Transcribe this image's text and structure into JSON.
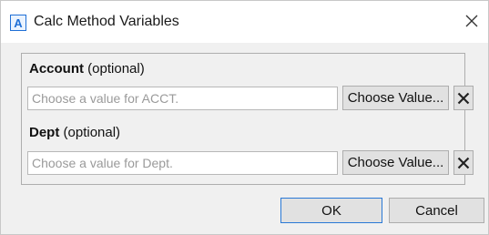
{
  "window": {
    "title": "Calc Method Variables",
    "app_icon_letter": "A",
    "app_icon": "app-logo-icon",
    "close_icon": "close-icon"
  },
  "fields": [
    {
      "label": "Account",
      "qualifier": "(optional)",
      "value": "",
      "placeholder": "Choose a value for ACCT.",
      "choose_label": "Choose Value...",
      "clear_icon": "clear-x-icon"
    },
    {
      "label": "Dept",
      "qualifier": "(optional)",
      "value": "",
      "placeholder": "Choose a value for Dept.",
      "choose_label": "Choose Value...",
      "clear_icon": "clear-x-icon"
    }
  ],
  "footer": {
    "ok_label": "OK",
    "cancel_label": "Cancel"
  },
  "colors": {
    "accent": "#1f6fd6",
    "dialog_bg": "#f0f0f0",
    "button_bg": "#e1e1e1"
  }
}
